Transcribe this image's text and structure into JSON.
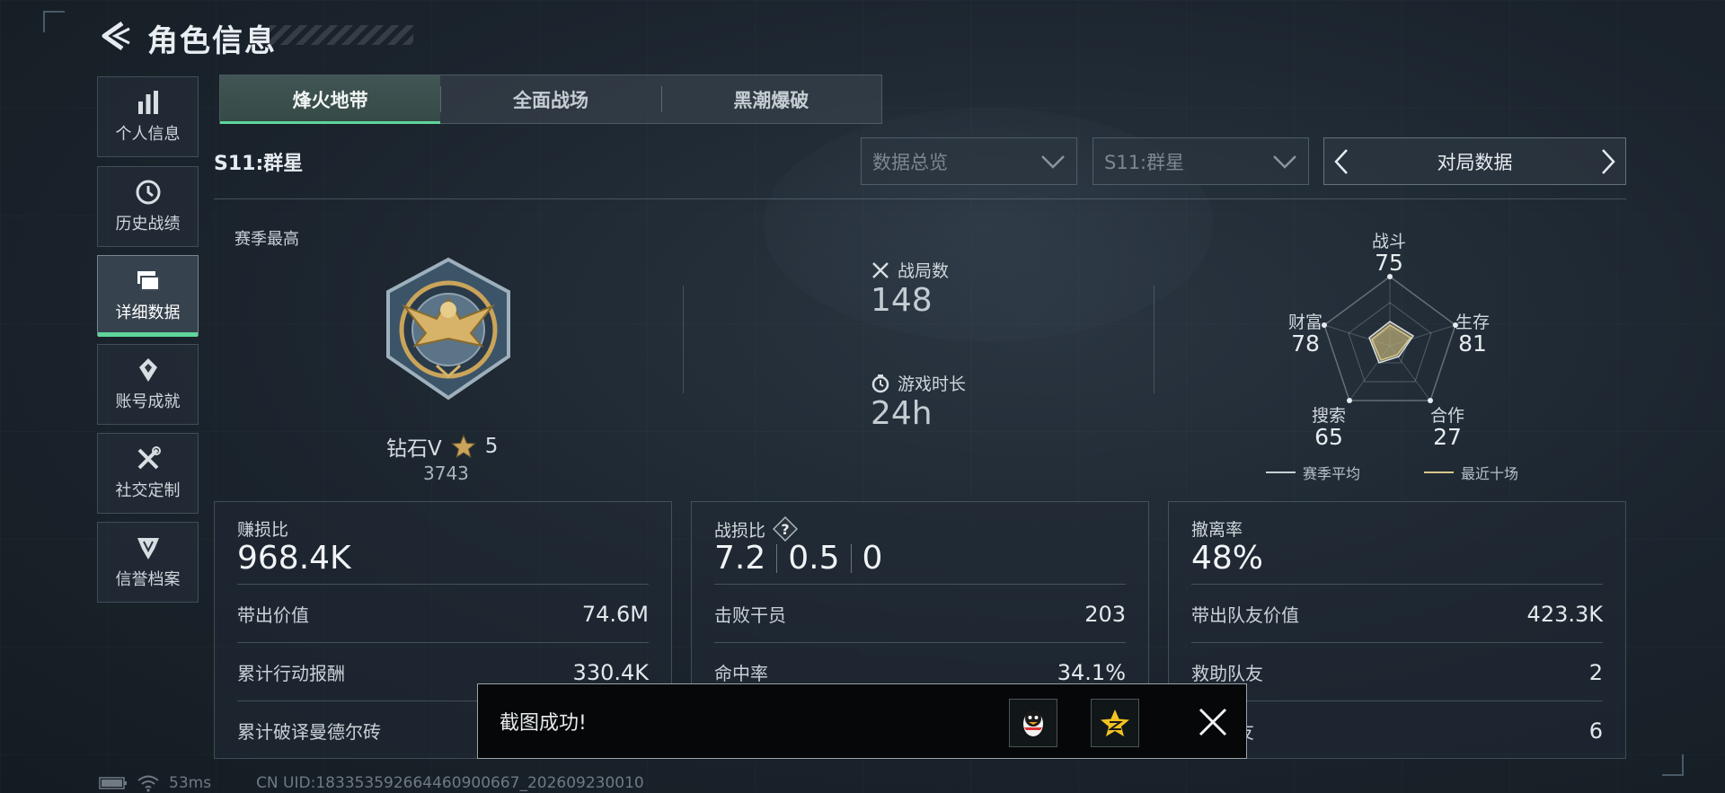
{
  "header": {
    "title": "角色信息"
  },
  "sidebar": {
    "items": [
      {
        "label": "个人信息",
        "icon": "bar-chart-icon"
      },
      {
        "label": "历史战绩",
        "icon": "clock-icon"
      },
      {
        "label": "详细数据",
        "icon": "folder-icon",
        "active": true
      },
      {
        "label": "账号成就",
        "icon": "medal-icon"
      },
      {
        "label": "社交定制",
        "icon": "tools-icon"
      },
      {
        "label": "信誉档案",
        "icon": "shield-icon"
      }
    ]
  },
  "tabs": [
    {
      "label": "烽火地带",
      "active": true
    },
    {
      "label": "全面战场"
    },
    {
      "label": "黑潮爆破"
    }
  ],
  "season_label": "S11:群星",
  "filters": {
    "data_type": "数据总览",
    "season": "S11:群星",
    "switcher": "对局数据"
  },
  "summary": {
    "season_best_label": "赛季最高",
    "rank": "钻石V",
    "stars": "5",
    "score": "3743",
    "battles_label": "战局数",
    "battles": "148",
    "playtime_label": "游戏时长",
    "playtime": "24h"
  },
  "radar": {
    "axes": [
      {
        "label": "战斗",
        "value": "75"
      },
      {
        "label": "生存",
        "value": "81"
      },
      {
        "label": "合作",
        "value": "27"
      },
      {
        "label": "搜索",
        "value": "65"
      },
      {
        "label": "财富",
        "value": "78"
      }
    ],
    "legend": [
      {
        "label": "赛季平均",
        "color": "#c8d0d6"
      },
      {
        "label": "最近十场",
        "color": "#d8c78a"
      }
    ]
  },
  "panels": {
    "profit": {
      "title": "赚损比",
      "value": "968.4K",
      "rows": [
        {
          "label": "带出价值",
          "value": "74.6M"
        },
        {
          "label": "累计行动报酬",
          "value": "330.4K"
        },
        {
          "label": "累计破译曼德尔砖",
          "value": ""
        }
      ]
    },
    "kd": {
      "title": "战损比",
      "values": [
        "7.2",
        "0.5",
        "0"
      ],
      "rows": [
        {
          "label": "击败干员",
          "value": "203"
        },
        {
          "label": "命中率",
          "value": "34.1%"
        },
        {
          "label": "",
          "value": ""
        }
      ]
    },
    "extract": {
      "title": "撤离率",
      "value": "48%",
      "rows": [
        {
          "label": "带出队友价值",
          "value": "423.3K"
        },
        {
          "label": "救助队友",
          "value": "2"
        },
        {
          "label": "友",
          "value": "6"
        }
      ]
    }
  },
  "toast": {
    "text": "截图成功!"
  },
  "footer": {
    "ping": "53ms",
    "uid": "CN UID:18335359266446090066​7_202609230010"
  }
}
